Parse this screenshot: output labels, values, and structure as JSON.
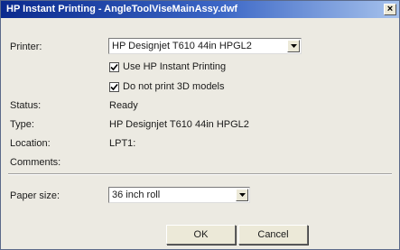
{
  "window": {
    "title": "HP Instant Printing - AngleToolViseMainAssy.dwf",
    "close_glyph": "×"
  },
  "printer": {
    "label": "Printer:",
    "selected": "HP Designjet T610 44in HPGL2",
    "use_instant_printing": {
      "label": "Use HP Instant Printing",
      "checked": true
    },
    "no_3d_models": {
      "label": "Do not print 3D models",
      "checked": true
    }
  },
  "info": {
    "status_label": "Status:",
    "status_value": "Ready",
    "type_label": "Type:",
    "type_value": "HP Designjet T610 44in HPGL2",
    "location_label": "Location:",
    "location_value": "LPT1:",
    "comments_label": "Comments:",
    "comments_value": ""
  },
  "paper": {
    "label": "Paper size:",
    "selected": "36 inch roll"
  },
  "buttons": {
    "ok": "OK",
    "cancel": "Cancel"
  },
  "icons": {
    "dropdown": "chevron-down-icon",
    "check": "checkmark-icon",
    "close": "close-icon"
  }
}
